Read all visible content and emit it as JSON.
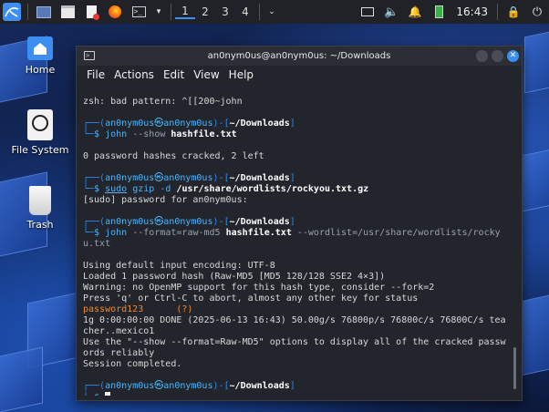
{
  "taskbar": {
    "workspaces": [
      "1",
      "2",
      "3",
      "4"
    ],
    "clock": "16:43"
  },
  "desktop": {
    "icons": [
      {
        "label": "Home"
      },
      {
        "label": "File System"
      },
      {
        "label": "Trash"
      }
    ]
  },
  "terminal": {
    "title": "an0nym0us@an0nym0us: ~/Downloads",
    "menu": [
      "File",
      "Actions",
      "Edit",
      "View",
      "Help"
    ],
    "prompt": {
      "user": "an0nym0us",
      "at": "㉿",
      "host": "an0nym0us",
      "path": "~/Downloads",
      "dollar": "$"
    },
    "lines": {
      "l1": "zsh: bad pattern: ^[[200~john",
      "c1_cmd": "john",
      "c1_opt": "--show",
      "c1_arg": "hashfile.txt",
      "o1": "0 password hashes cracked, 2 left",
      "c2_sudo": "sudo",
      "c2_cmd": "gzip -d",
      "c2_arg": "/usr/share/wordlists/rockyou.txt.gz",
      "o2": "[sudo] password for an0nym0us:",
      "c3_cmd": "john",
      "c3_opt1": "--format=raw-md5",
      "c3_arg": "hashfile.txt",
      "c3_opt2": "--wordlist=/usr/share/wordlists/rocky",
      "c3_wrap": "u.txt",
      "o3_1": "Using default input encoding: UTF-8",
      "o3_2": "Loaded 1 password hash (Raw-MD5 [MD5 128/128 SSE2 4×3])",
      "o3_3": "Warning: no OpenMP support for this hash type, consider --fork=2",
      "o3_4": "Press 'q' or Ctrl-C to abort, almost any other key for status",
      "o3_pw": "password123",
      "o3_pw_tag": "(?)",
      "o3_6": "1g 0:00:00:00 DONE (2025-06-13 16:43) 50.00g/s 76800p/s 76800c/s 76800C/s tea",
      "o3_7": "cher..mexico1",
      "o3_8": "Use the \"--show --format=Raw-MD5\" options to display all of the cracked passw",
      "o3_9": "ords reliably",
      "o3_10": "Session completed."
    }
  }
}
